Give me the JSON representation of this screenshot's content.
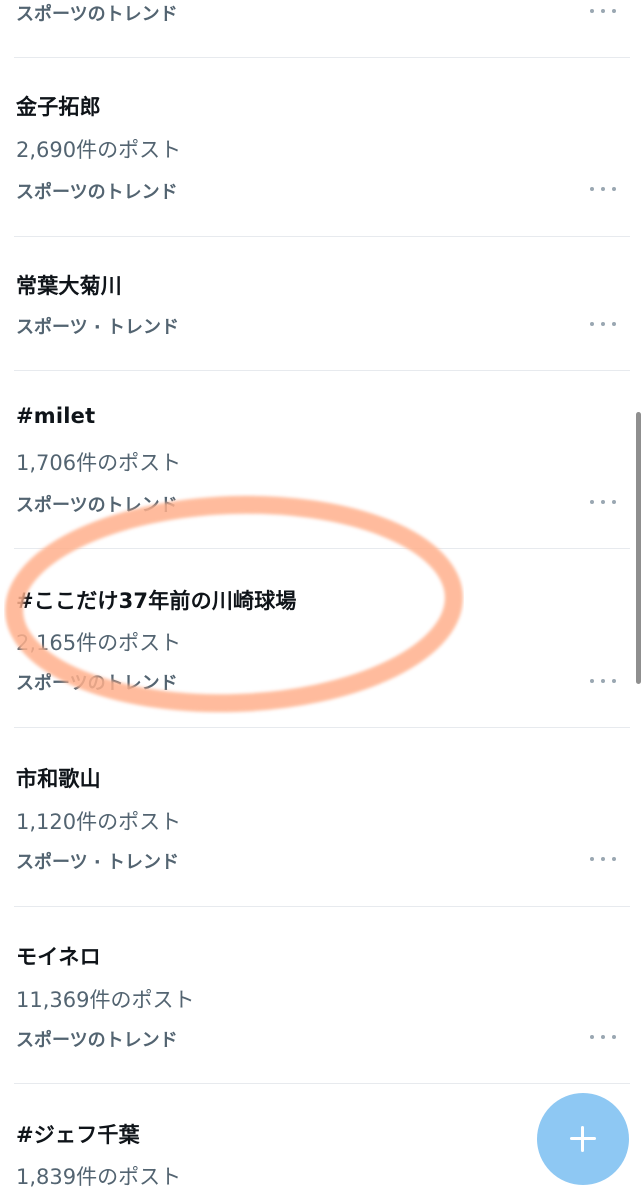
{
  "trends": [
    {
      "title": "",
      "count": "",
      "category": "スポーツのトレンド"
    },
    {
      "title": "金子拓郎",
      "count": "2,690件のポスト",
      "category": "スポーツのトレンド"
    },
    {
      "title": "常葉大菊川",
      "count": "",
      "category": "スポーツ · トレンド"
    },
    {
      "title": "#milet",
      "count": "1,706件のポスト",
      "category": "スポーツのトレンド"
    },
    {
      "title": "#ここだけ37年前の川崎球場",
      "count": "2,165件のポスト",
      "category": "スポーツのトレンド"
    },
    {
      "title": "市和歌山",
      "count": "1,120件のポスト",
      "category": "スポーツ · トレンド"
    },
    {
      "title": "モイネロ",
      "count": "11,369件のポスト",
      "category": "スポーツのトレンド"
    },
    {
      "title": "#ジェフ千葉",
      "count": "1,839件のポスト",
      "category": ""
    }
  ],
  "icons": {
    "more": "more-horizontal-icon",
    "compose": "plus-icon"
  },
  "colors": {
    "highlight": "#ffb08c",
    "fab": "#8ec8f3",
    "text_primary": "#0f1419",
    "text_secondary": "#536471"
  }
}
